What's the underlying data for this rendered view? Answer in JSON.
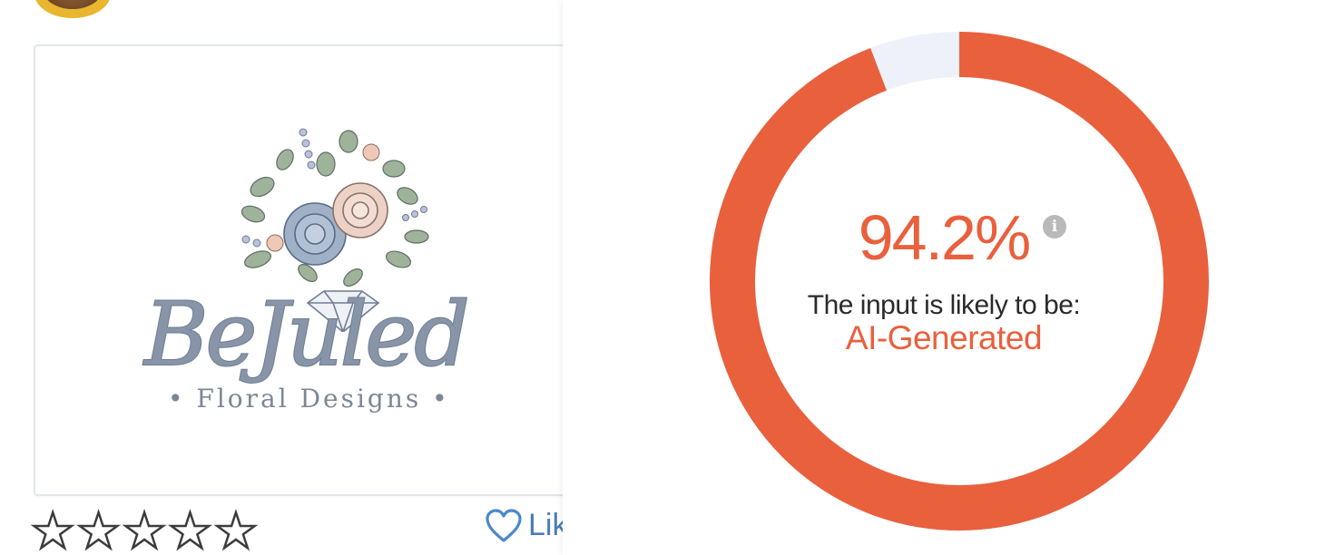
{
  "listing": {
    "brand_wordmark": "BeJuled",
    "brand_subtitle": "• Floral Designs •",
    "rating_stars": 0,
    "rating_max": 5,
    "like_label": "Lik"
  },
  "detector": {
    "score_text": "94.2%",
    "score_fraction": 0.942,
    "caption": "The input is likely to be:",
    "verdict": "AI-Generated",
    "info_icon": "info-icon",
    "colors": {
      "accent": "#e9603d",
      "ring_remainder": "#eef1fa",
      "info_icon": "#b9b9b9"
    }
  }
}
